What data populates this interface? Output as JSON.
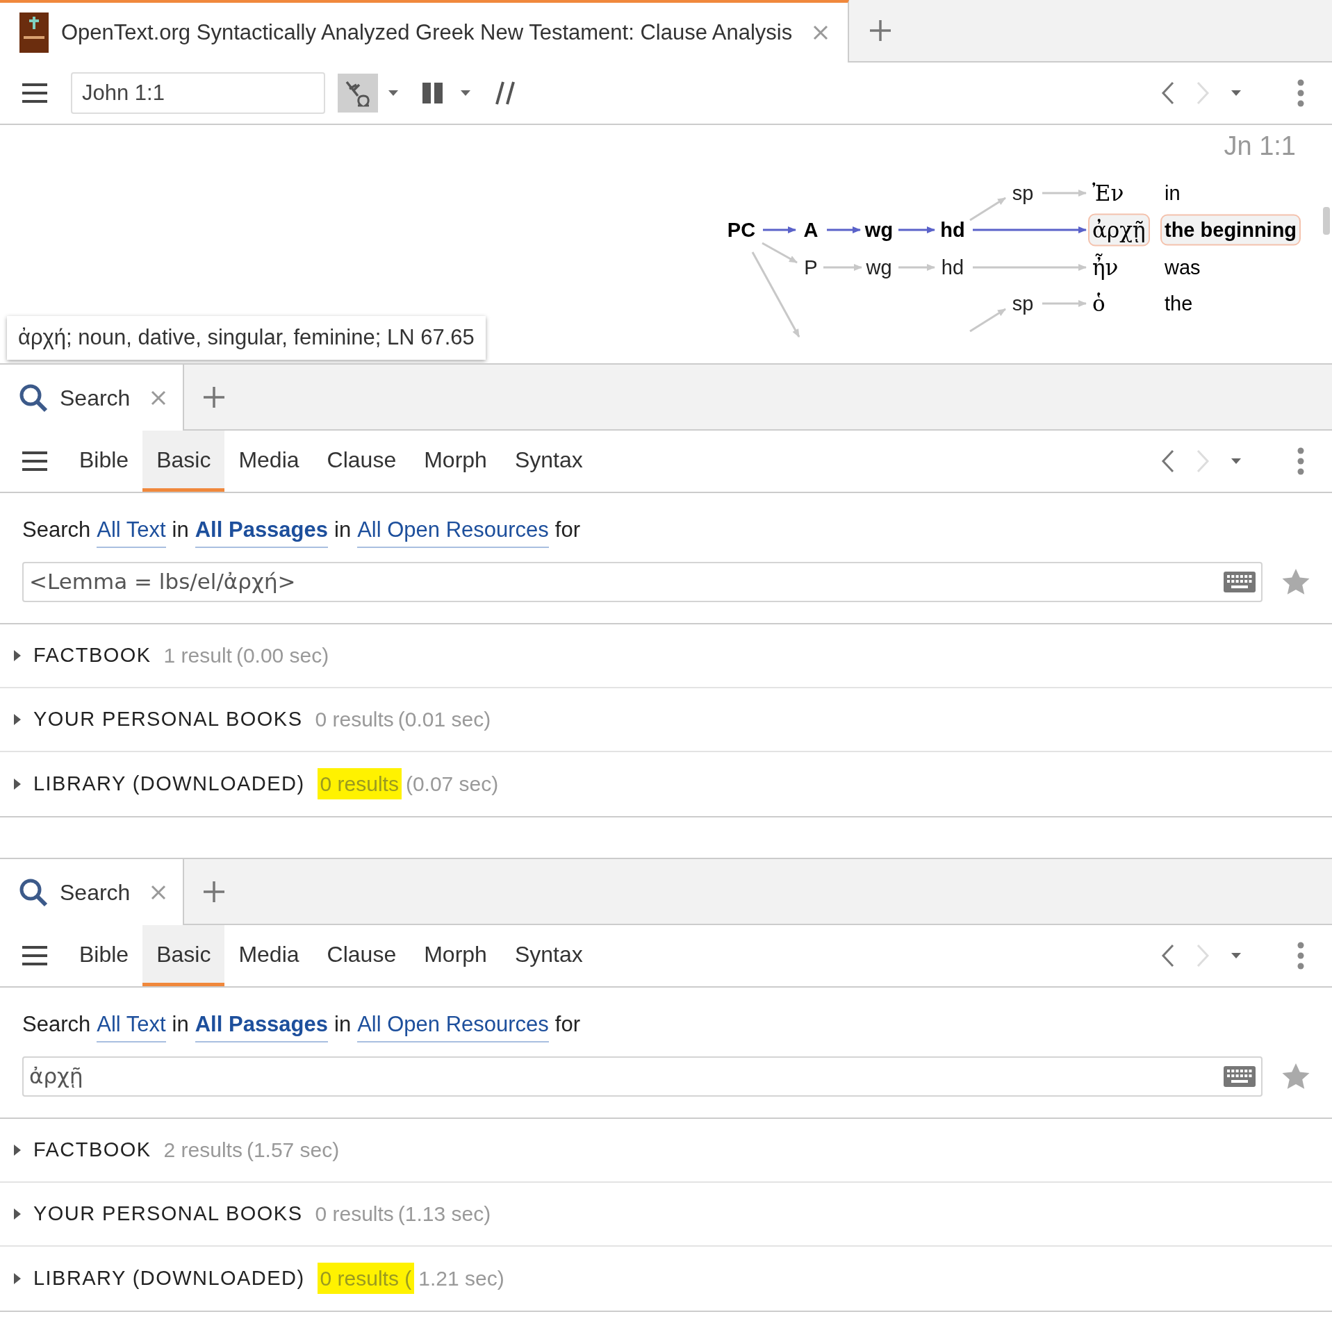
{
  "window": {
    "tab": {
      "title": "OpenText.org Syntactically Analyzed Greek New Testament: Clause Analysis",
      "selected": true
    }
  },
  "toolbar": {
    "reference": "John 1:1",
    "interlinear_on": true
  },
  "diagram": {
    "reference": "Jn 1:1",
    "nodes": [
      {
        "label": "PC",
        "selected": true
      },
      {
        "label": "A",
        "selected": true
      },
      {
        "label": "wg",
        "selected": true
      },
      {
        "label": "hd",
        "selected": true
      },
      {
        "label": "sp",
        "selected": false
      },
      {
        "label": "P",
        "selected": false
      },
      {
        "label": "wg",
        "selected": false
      },
      {
        "label": "hd",
        "selected": false
      },
      {
        "label": "sp",
        "selected": false
      }
    ],
    "words": [
      {
        "greek": "Ἐν",
        "gloss": "in",
        "selected": false
      },
      {
        "greek": "ἀρχῇ",
        "gloss": "the beginning",
        "selected": true
      },
      {
        "greek": "ἦν",
        "gloss": "was",
        "selected": false
      },
      {
        "greek": "ὁ",
        "gloss": "the",
        "selected": false
      }
    ],
    "tooltip": "ἀρχή; noun, dative, singular, feminine; LN 67.65"
  },
  "panels": [
    {
      "tab": "Search",
      "subtabs": [
        {
          "label": "Bible",
          "selected": false
        },
        {
          "label": "Basic",
          "selected": true
        },
        {
          "label": "Media",
          "selected": false
        },
        {
          "label": "Clause",
          "selected": false
        },
        {
          "label": "Morph",
          "selected": false
        },
        {
          "label": "Syntax",
          "selected": false
        }
      ],
      "query_line": [
        {
          "text": "Search",
          "kind": "plain"
        },
        {
          "text": "All Text",
          "kind": "link"
        },
        {
          "text": "in",
          "kind": "plain"
        },
        {
          "text": "All Passages",
          "kind": "strong_link"
        },
        {
          "text": "in",
          "kind": "plain"
        },
        {
          "text": "All Open Resources",
          "kind": "link"
        },
        {
          "text": "for",
          "kind": "plain"
        }
      ],
      "query": "<Lemma = lbs/el/ἀρχή>",
      "results": [
        {
          "label": "FACTBOOK",
          "count": "1 result",
          "time": "(0.00 sec)",
          "highlighted": false
        },
        {
          "label": "YOUR PERSONAL BOOKS",
          "count": "0 results",
          "time": "(0.01 sec)",
          "highlighted": false
        },
        {
          "label": "LIBRARY (DOWNLOADED)",
          "count": "0 results",
          "time": "(0.07 sec)",
          "highlighted": true
        }
      ]
    },
    {
      "tab": "Search",
      "subtabs": [
        {
          "label": "Bible",
          "selected": false
        },
        {
          "label": "Basic",
          "selected": true
        },
        {
          "label": "Media",
          "selected": false
        },
        {
          "label": "Clause",
          "selected": false
        },
        {
          "label": "Morph",
          "selected": false
        },
        {
          "label": "Syntax",
          "selected": false
        }
      ],
      "query_line": [
        {
          "text": "Search",
          "kind": "plain"
        },
        {
          "text": "All Text",
          "kind": "link"
        },
        {
          "text": "in",
          "kind": "plain"
        },
        {
          "text": "All Passages",
          "kind": "strong_link"
        },
        {
          "text": "in",
          "kind": "plain"
        },
        {
          "text": "All Open Resources",
          "kind": "link"
        },
        {
          "text": "for",
          "kind": "plain"
        }
      ],
      "query": "ἀρχῇ",
      "results": [
        {
          "label": "FACTBOOK",
          "count": "2 results",
          "time": "(1.57 sec)",
          "highlighted": false
        },
        {
          "label": "YOUR PERSONAL BOOKS",
          "count": "0 results",
          "time": "(1.13 sec)",
          "highlighted": false
        },
        {
          "label": "LIBRARY (DOWNLOADED)",
          "count": "0 results (",
          "time": "1.21 sec)",
          "highlighted": true
        }
      ]
    }
  ]
}
